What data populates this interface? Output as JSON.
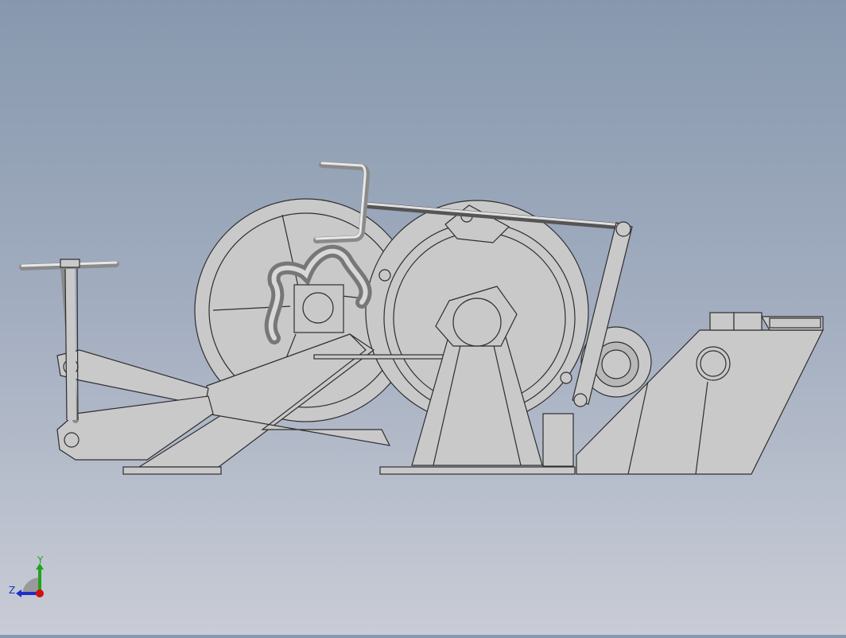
{
  "viewport": {
    "background_top": "#8798ae",
    "background_bottom": "#c9ccd6"
  },
  "triad": {
    "y_label": "Y",
    "z_label": "Z",
    "colors": {
      "y": "#1fa31f",
      "z": "#1e2fc8",
      "x": "#d01010"
    }
  }
}
